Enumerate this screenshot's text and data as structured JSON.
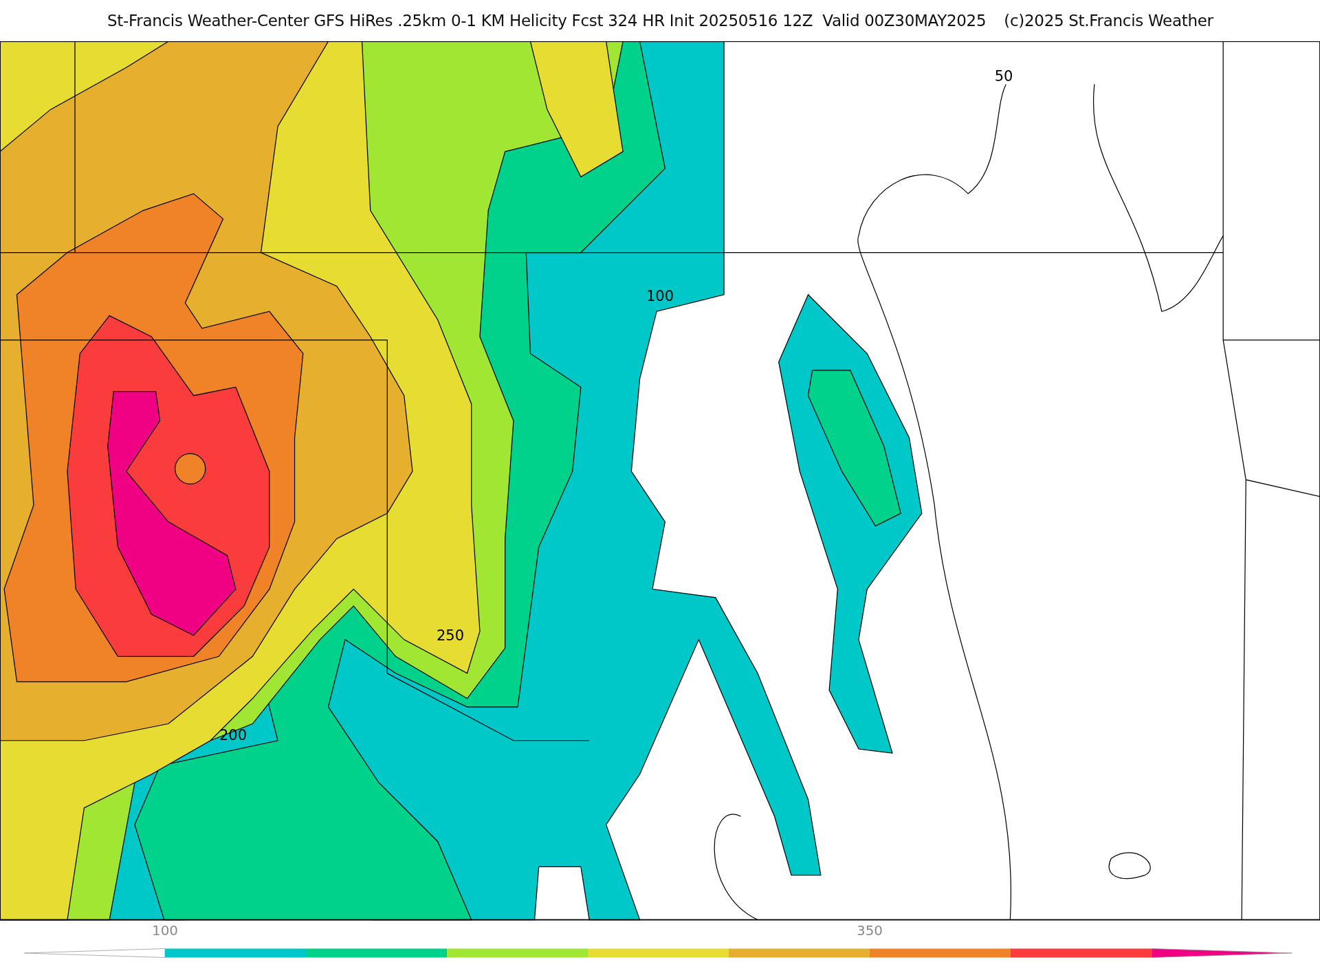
{
  "title": "St-Francis Weather-Center GFS HiRes .25km 0-1 KM Helicity Fcst 324 HR Init 20250516 12Z  Valid 00Z30MAY2025",
  "copyright": "(c)2025 St.Francis Weather",
  "map": {
    "contour_labels": [
      {
        "text": "50"
      },
      {
        "text": "100"
      },
      {
        "text": "250"
      },
      {
        "text": "200"
      }
    ]
  },
  "colorbar": {
    "segments": [
      {
        "kind": "under"
      },
      {
        "kind": "bin",
        "color": "#00c8c8",
        "tick": "100"
      },
      {
        "kind": "bin",
        "color": "#00d28c"
      },
      {
        "kind": "bin",
        "color": "#a0e632"
      },
      {
        "kind": "bin",
        "color": "#e6dc32"
      },
      {
        "kind": "bin",
        "color": "#e6af2d"
      },
      {
        "kind": "bin",
        "color": "#f08228",
        "tick": "350"
      },
      {
        "kind": "bin",
        "color": "#fa3c3c"
      },
      {
        "kind": "over",
        "color": "#f00082"
      }
    ]
  }
}
